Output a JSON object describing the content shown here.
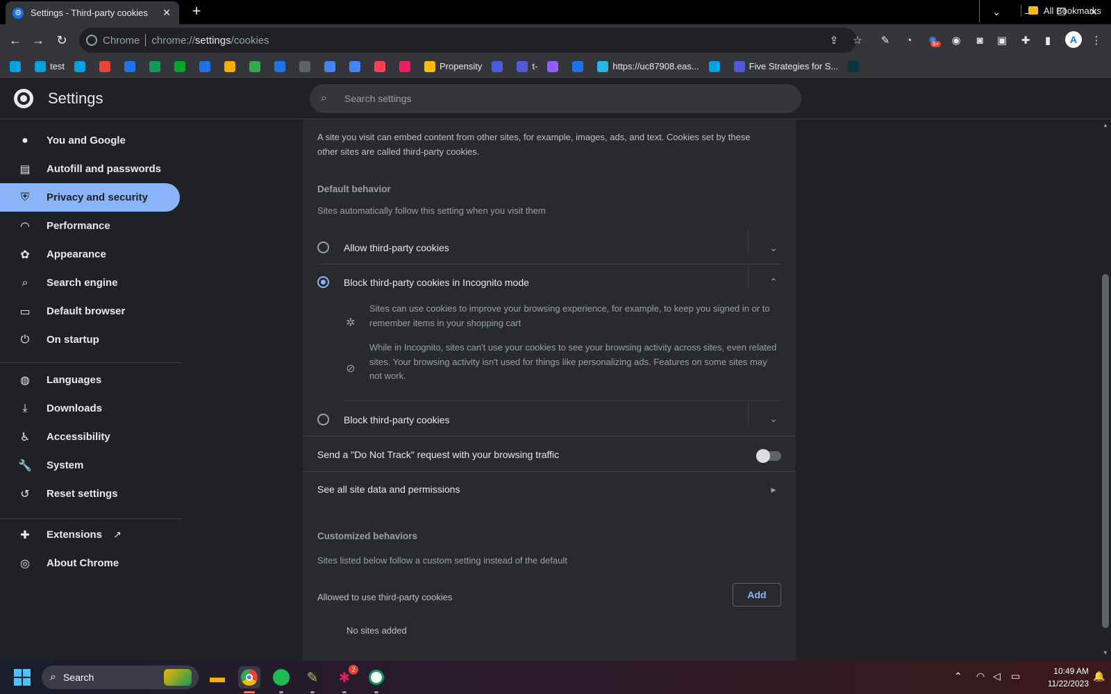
{
  "window": {
    "tab_title": "Settings - Third-party cookies",
    "tab_close": "✕",
    "new_tab": "+",
    "controls": [
      "⌄",
      "—",
      "❐",
      "✕"
    ]
  },
  "toolbar": {
    "chrome_label": "Chrome",
    "url_prefix": "chrome://",
    "url_host": "settings",
    "url_path": "/cookies",
    "extension_badge": "9+",
    "avatar_letter": "A"
  },
  "bookmarks": {
    "items": [
      {
        "label": "",
        "icon": "salesforce-icon",
        "color": "#00a1e0"
      },
      {
        "label": "test",
        "icon": "salesforce-icon",
        "color": "#00a1e0"
      },
      {
        "label": "",
        "icon": "salesforce-icon",
        "color": "#00a1e0"
      },
      {
        "label": "",
        "icon": "gmail-icon",
        "color": "#ea4335"
      },
      {
        "label": "",
        "icon": "calendar-icon",
        "color": "#1a73e8"
      },
      {
        "label": "",
        "icon": "drive-icon",
        "color": "#0f9d58"
      },
      {
        "label": "",
        "icon": "evernote-icon",
        "color": "#00a82d"
      },
      {
        "label": "",
        "icon": "a-icon",
        "color": "#1a73e8"
      },
      {
        "label": "",
        "icon": "analytics-icon",
        "color": "#f9ab00"
      },
      {
        "label": "",
        "icon": "circle-icon",
        "color": "#34a853"
      },
      {
        "label": "",
        "icon": "cloud-icon",
        "color": "#1a73e8"
      },
      {
        "label": "",
        "icon": "image-icon",
        "color": "#5f6368"
      },
      {
        "label": "",
        "icon": "g-icon",
        "color": "#4285f4"
      },
      {
        "label": "",
        "icon": "cloud-icon",
        "color": "#4285f4"
      },
      {
        "label": "",
        "icon": "monday-icon",
        "color": "#ff3d57"
      },
      {
        "label": "",
        "icon": "square-icon",
        "color": "#e91e63"
      },
      {
        "label": "Propensity",
        "icon": "folder-icon",
        "color": "#fbbc04"
      },
      {
        "label": "",
        "icon": "a-icon",
        "color": "#4b5bdc"
      },
      {
        "label": "t-",
        "icon": "a-icon",
        "color": "#4b5bdc"
      },
      {
        "label": "",
        "icon": "loop-icon",
        "color": "#8e5cf7"
      },
      {
        "label": "",
        "icon": "t-icon",
        "color": "#1a73e8"
      },
      {
        "label": "https://uc87908.eas...",
        "icon": "snowflake-icon",
        "color": "#29b5e8"
      },
      {
        "label": "",
        "icon": "salesforce-icon",
        "color": "#00a1e0"
      },
      {
        "label": "Five Strategies for S...",
        "icon": "a-icon",
        "color": "#4b5bdc"
      },
      {
        "label": "",
        "icon": "z-icon",
        "color": "#03363d"
      }
    ],
    "all_bookmarks": "All Bookmarks"
  },
  "settings_header": {
    "title": "Settings",
    "search_placeholder": "Search settings"
  },
  "nav": {
    "items": [
      {
        "label": "You and Google",
        "icon": "person-icon"
      },
      {
        "label": "Autofill and passwords",
        "icon": "clipboard-icon"
      },
      {
        "label": "Privacy and security",
        "icon": "shield-icon",
        "active": true
      },
      {
        "label": "Performance",
        "icon": "speedometer-icon"
      },
      {
        "label": "Appearance",
        "icon": "palette-icon"
      },
      {
        "label": "Search engine",
        "icon": "search-icon"
      },
      {
        "label": "Default browser",
        "icon": "browser-icon"
      },
      {
        "label": "On startup",
        "icon": "power-icon"
      },
      {
        "label": "Languages",
        "icon": "globe-icon"
      },
      {
        "label": "Downloads",
        "icon": "download-icon"
      },
      {
        "label": "Accessibility",
        "icon": "accessibility-icon"
      },
      {
        "label": "System",
        "icon": "wrench-icon"
      },
      {
        "label": "Reset settings",
        "icon": "history-icon"
      },
      {
        "label": "Extensions",
        "icon": "puzzle-icon"
      },
      {
        "label": "About Chrome",
        "icon": "chrome-icon"
      }
    ]
  },
  "content": {
    "intro": "A site you visit can embed content from other sites, for example, images, ads, and text. Cookies set by these other sites are called third-party cookies.",
    "default_heading": "Default behavior",
    "default_sub": "Sites automatically follow this setting when you visit them",
    "option_allow": "Allow third-party cookies",
    "option_block_incognito": "Block third-party cookies in Incognito mode",
    "expanded_1": "Sites can use cookies to improve your browsing experience, for example, to keep you signed in or to remember items in your shopping cart",
    "expanded_2": "While in Incognito, sites can't use your cookies to see your browsing activity across sites, even related sites. Your browsing activity isn't used for things like personalizing ads. Features on some sites may not work.",
    "option_block": "Block third-party cookies",
    "selected_option": "Block third-party cookies in Incognito mode",
    "dnt_label": "Send a \"Do Not Track\" request with your browsing traffic",
    "dnt_enabled": false,
    "site_data_link": "See all site data and permissions",
    "custom_heading": "Customized behaviors",
    "custom_sub": "Sites listed below follow a custom setting instead of the default",
    "allowed_label": "Allowed to use third-party cookies",
    "add_button": "Add",
    "no_sites": "No sites added"
  },
  "taskbar": {
    "search_label": "Search",
    "slack_badge": "2",
    "time": "10:49 AM",
    "date": "11/22/2023"
  }
}
